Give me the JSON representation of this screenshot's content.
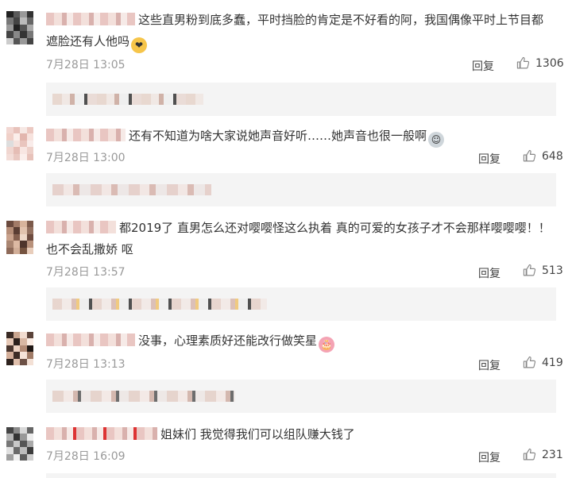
{
  "comments": [
    {
      "text": "这些直男粉到底多蠢，平时挡脸的肯定是不好看的阿，我国偶像平时上节目都遮脸还有人他吗",
      "time": "7月28日 13:05",
      "reply_label": "回复",
      "likes": "1306"
    },
    {
      "text": "还有不知道为啥大家说她声音好听……她声音也很一般啊",
      "time": "7月28日 13:00",
      "reply_label": "回复",
      "likes": "648"
    },
    {
      "text": "都2019了 直男怎么还对嘤嘤怪这么执着 真的可爱的女孩子才不会那样嘤嘤嘤！！也不会乱撒娇 呕",
      "time": "7月28日 13:57",
      "reply_label": "回复",
      "likes": "513"
    },
    {
      "text": "没事，心理素质好还能改行做笑星",
      "time": "7月28日 13:13",
      "reply_label": "回复",
      "likes": "419"
    },
    {
      "text": "姐妹们 我觉得我们可以组队赚大钱了",
      "time": "7月28日 16:09",
      "reply_label": "回复",
      "likes": "231"
    }
  ],
  "colors": {
    "text": "#333333",
    "meta": "#999999",
    "subcomment_bg": "#f4f4f4",
    "like_icon": "#888888"
  },
  "icons": [
    "thumbs-up-icon"
  ]
}
